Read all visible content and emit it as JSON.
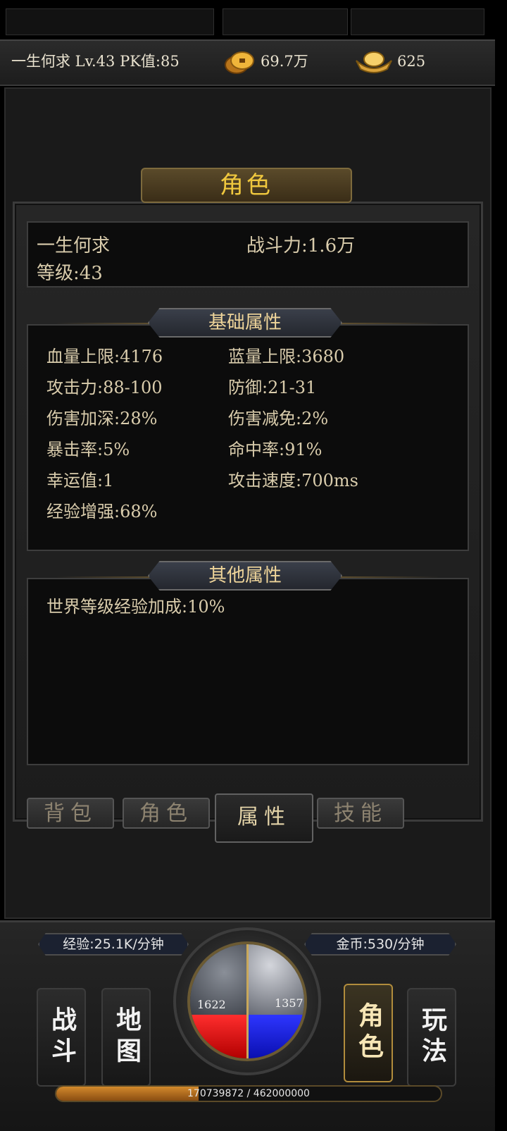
{
  "header": {
    "player_info": "一生何求  Lv.43 PK值:85",
    "gold": "69.7万",
    "ingot": "625",
    "gold_icon": "gold-coins-icon",
    "ingot_icon": "gold-ingot-icon"
  },
  "panel": {
    "title": "角色",
    "character": {
      "name": "一生何求",
      "power": "战斗力:1.6万",
      "level": "等级:43"
    },
    "basic": {
      "title": "基础属性",
      "stats_left": [
        "血量上限:4176",
        "攻击力:88-100",
        "伤害加深:28%",
        "暴击率:5%",
        "幸运值:1",
        "经验增强:68%"
      ],
      "stats_right": [
        "蓝量上限:3680",
        "防御:21-31",
        "伤害减免:2%",
        "命中率:91%",
        "攻击速度:700ms"
      ]
    },
    "other": {
      "title": "其他属性",
      "stats": [
        "世界等级经验加成:10%"
      ]
    },
    "tabs": [
      "背包",
      "角色",
      "属性",
      "技能"
    ],
    "active_tab": "属性"
  },
  "hud": {
    "exp_rate": "经验:25.1K/分钟",
    "gold_rate": "金币:530/分钟",
    "hp": "1622",
    "mp": "1357",
    "exp_text": "170739872 / 462000000",
    "exp_progress": 0.3696,
    "menu": [
      "战斗",
      "地图",
      "角色",
      "玩法"
    ],
    "active_menu": "角色"
  },
  "colors": {
    "accent_gold": "#f0c83e",
    "hp_red": "#ff2e2e",
    "mp_blue": "#2e36ff"
  }
}
